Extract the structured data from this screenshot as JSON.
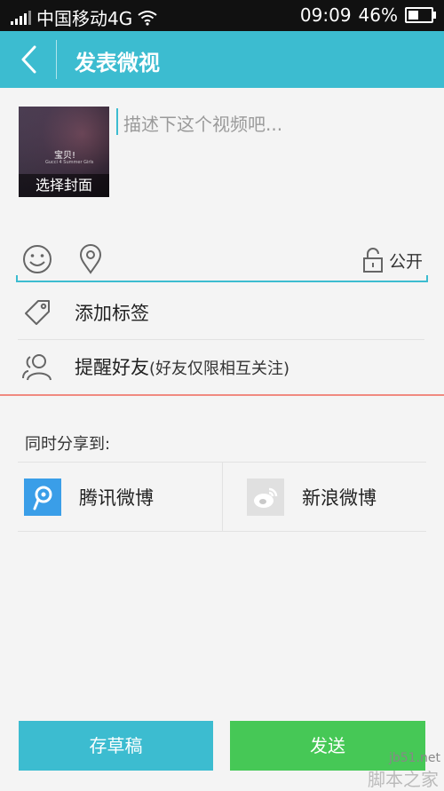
{
  "status_bar": {
    "carrier": "中国移动4G",
    "time": "09:09",
    "battery_percent": "46%",
    "battery_level": 0.46,
    "signal_icon": "signal-icon",
    "wifi_icon": "wifi-icon"
  },
  "header": {
    "title": "发表微视",
    "back_icon": "chevron-left-icon",
    "bg_color": "#3cbcd0"
  },
  "cover": {
    "overlay_title": "宝贝!",
    "overlay_subtitle": "Gucci 4 Summer Girls",
    "caption": "选择封面"
  },
  "description": {
    "placeholder": "描述下这个视频吧...",
    "value": ""
  },
  "toolbar": {
    "emoji_icon": "emoji-icon",
    "location_icon": "location-pin-icon",
    "privacy_icon": "unlock-icon",
    "privacy_label": "公开"
  },
  "options": {
    "add_tag_label": "添加标签",
    "mention_label": "提醒好友",
    "mention_note": "(好友仅限相互关注)"
  },
  "share": {
    "label": "同时分享到:",
    "targets": [
      {
        "name": "腾讯微博",
        "icon": "tencent-weibo-icon",
        "color": "#3a9ee8"
      },
      {
        "name": "新浪微博",
        "icon": "sina-weibo-icon",
        "color": "#b8b8b8"
      }
    ]
  },
  "actions": {
    "draft_label": "存草稿",
    "send_label": "发送",
    "draft_color": "#3cbcd0",
    "send_color": "#46c856"
  },
  "watermark": {
    "line1": "jb51.net",
    "line2": "脚本之家"
  }
}
